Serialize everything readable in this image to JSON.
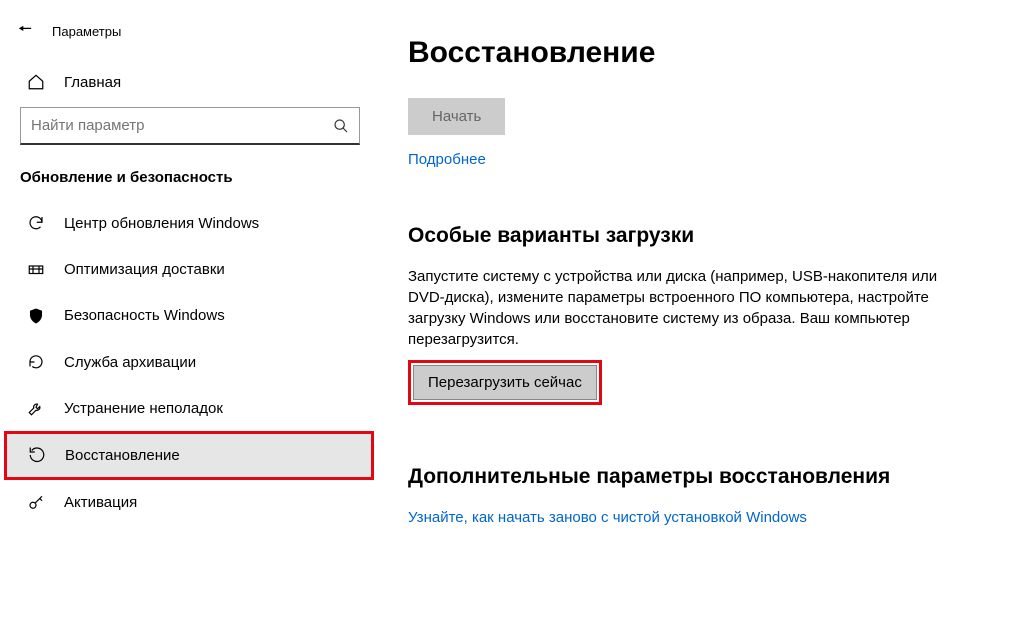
{
  "header": {
    "app_title": "Параметры"
  },
  "sidebar": {
    "home": "Главная",
    "search_placeholder": "Найти параметр",
    "category": "Обновление и безопасность",
    "items": [
      {
        "label": "Центр обновления Windows"
      },
      {
        "label": "Оптимизация доставки"
      },
      {
        "label": "Безопасность Windows"
      },
      {
        "label": "Служба архивации"
      },
      {
        "label": "Устранение неполадок"
      },
      {
        "label": "Восстановление"
      },
      {
        "label": "Активация"
      }
    ]
  },
  "main": {
    "title": "Восстановление",
    "start_label": "Начать",
    "more_info": "Подробнее",
    "advanced": {
      "heading": "Особые варианты загрузки",
      "desc": "Запустите систему с устройства или диска (например, USB-накопителя или DVD-диска), измените параметры встроенного ПО компьютера, настройте загрузку Windows или восстановите систему из образа. Ваш компьютер перезагрузится.",
      "restart_label": "Перезагрузить сейчас"
    },
    "extra": {
      "heading": "Дополнительные параметры восстановления",
      "link": "Узнайте, как начать заново с чистой установкой Windows"
    }
  }
}
